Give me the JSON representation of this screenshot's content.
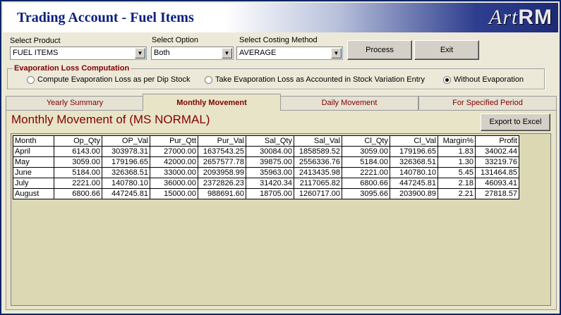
{
  "window": {
    "title": "Trading Account - Fuel Items",
    "logo_art": "Art",
    "logo_rm": "RM"
  },
  "filters": {
    "product_label": "Select Product",
    "product_value": "FUEL ITEMS",
    "option_label": "Select Option",
    "option_value": "Both",
    "costing_label": "Select Costing Method",
    "costing_value": "AVERAGE"
  },
  "buttons": {
    "process": "Process",
    "exit": "Exit",
    "export": "Export to Excel"
  },
  "evaporation": {
    "legend": "Evaporation Loss Computation",
    "options": [
      {
        "label": "Compute Evaporation Loss as per Dip Stock",
        "selected": false
      },
      {
        "label": "Take Evaporation Loss as Accounted in Stock Variation Entry",
        "selected": false
      },
      {
        "label": "Without Evaporation",
        "selected": true
      }
    ]
  },
  "tabs": [
    {
      "label": "Yearly Summary",
      "active": false
    },
    {
      "label": "Monthly Movement",
      "active": true
    },
    {
      "label": "Daily Movement",
      "active": false
    },
    {
      "label": "For Specified Period",
      "active": false
    }
  ],
  "panel": {
    "heading": "Monthly Movement of (MS NORMAL)"
  },
  "table": {
    "columns": [
      "Month",
      "Op_Qty",
      "OP_Val",
      "Pur_Qtt",
      "Pur_Val",
      "Sal_Qty",
      "Sal_Val",
      "Cl_Qty",
      "Cl_Val",
      "Margin%",
      "Profit"
    ],
    "rows": [
      [
        "April",
        "6143.00",
        "303978.31",
        "27000.00",
        "1637543.25",
        "30084.00",
        "1858589.52",
        "3059.00",
        "179196.65",
        "1.83",
        "34002.44"
      ],
      [
        "May",
        "3059.00",
        "179196.65",
        "42000.00",
        "2657577.78",
        "39875.00",
        "2556336.76",
        "5184.00",
        "326368.51",
        "1.30",
        "33219.76"
      ],
      [
        "June",
        "5184.00",
        "326368.51",
        "33000.00",
        "2093958.99",
        "35963.00",
        "2413435.98",
        "2221.00",
        "140780.10",
        "5.45",
        "131464.85"
      ],
      [
        "July",
        "2221.00",
        "140780.10",
        "36000.00",
        "2372826.23",
        "31420.34",
        "2117065.82",
        "6800.66",
        "447245.81",
        "2.18",
        "46093.41"
      ],
      [
        "August",
        "6800.66",
        "447245.81",
        "15000.00",
        "988691.60",
        "18705.00",
        "1260717.00",
        "3095.66",
        "203900.89",
        "2.21",
        "27818.57"
      ]
    ]
  }
}
